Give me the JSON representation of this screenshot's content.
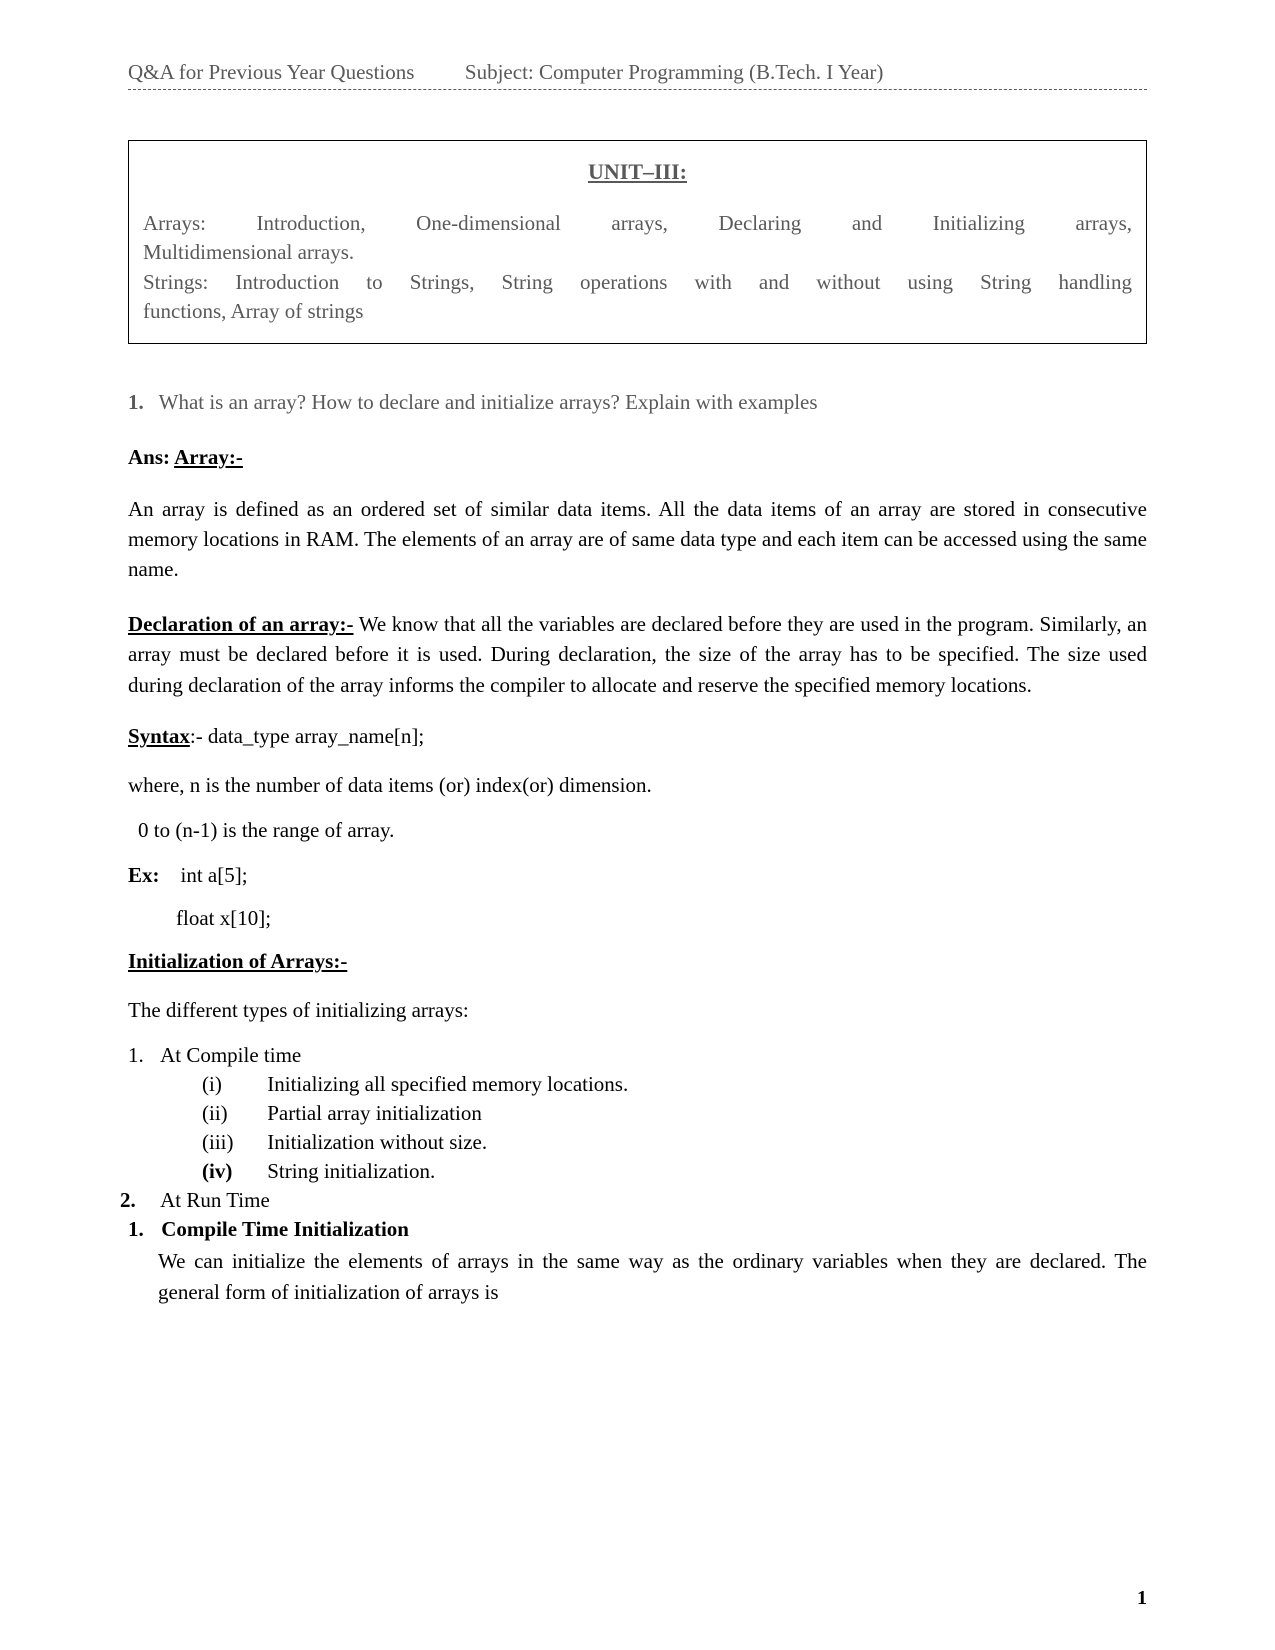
{
  "header": {
    "left": "Q&A  for Previous Year Questions",
    "right": "Subject: Computer Programming (B.Tech. I Year)"
  },
  "unit": {
    "title": "UNIT–III:",
    "line1": "Arrays:    Introduction,    One-dimensional    arrays,    Declaring    and    Initializing    arrays,",
    "line2": "Multidimensional arrays.",
    "line3": "Strings:  Introduction  to  Strings,  String  operations  with  and  without  using  String  handling",
    "line4": "functions, Array of strings"
  },
  "question": {
    "num": "1.",
    "text": "What is an array? How to declare and initialize arrays? Explain with examples"
  },
  "ans": {
    "label": "Ans:",
    "title": "Array:-"
  },
  "para1": " An array is defined as an ordered set of similar data items. All the data items of an array are stored in consecutive memory locations in RAM. The elements of an array are of same data type and each item can be accessed using the same name.",
  "decl": {
    "title": "Declaration of an array:-",
    "text": " We know that all the variables are declared before they are used in the program. Similarly, an array must be declared before it is used. During declaration, the size of the array has to be specified. The size used during declaration of the array informs the compiler to allocate and reserve the specified memory locations."
  },
  "syntax": {
    "label": "Syntax",
    "text": ":-    data_type  array_name[n];"
  },
  "where": "where, n is the number of data items (or) index(or) dimension.",
  "range": "0 to (n-1) is the range of array.",
  "ex": {
    "label": "Ex:",
    "line1": "int     a[5];",
    "line2": "float  x[10];"
  },
  "init": {
    "title": "Initialization of Arrays:-",
    "intro": "The different types of initializing arrays:"
  },
  "list": {
    "item1": {
      "num": "1.",
      "text": "At Compile time"
    },
    "sub1": {
      "roman": "(i)",
      "text": "Initializing all specified memory locations."
    },
    "sub2": {
      "roman": "(ii)",
      "text": "Partial array initialization"
    },
    "sub3": {
      "roman": "(iii)",
      "text": "Initialization without size."
    },
    "sub4": {
      "roman": "(iv)",
      "text": "String initialization."
    },
    "item2": {
      "num": "2.",
      "text": "At Run Time"
    },
    "item3": {
      "num": "1.",
      "text": "Compile Time Initialization"
    },
    "continue": "We can initialize the elements of arrays in the same way as the ordinary variables when they are declared. The general form of initialization of arrays is"
  },
  "pageNum": "1"
}
